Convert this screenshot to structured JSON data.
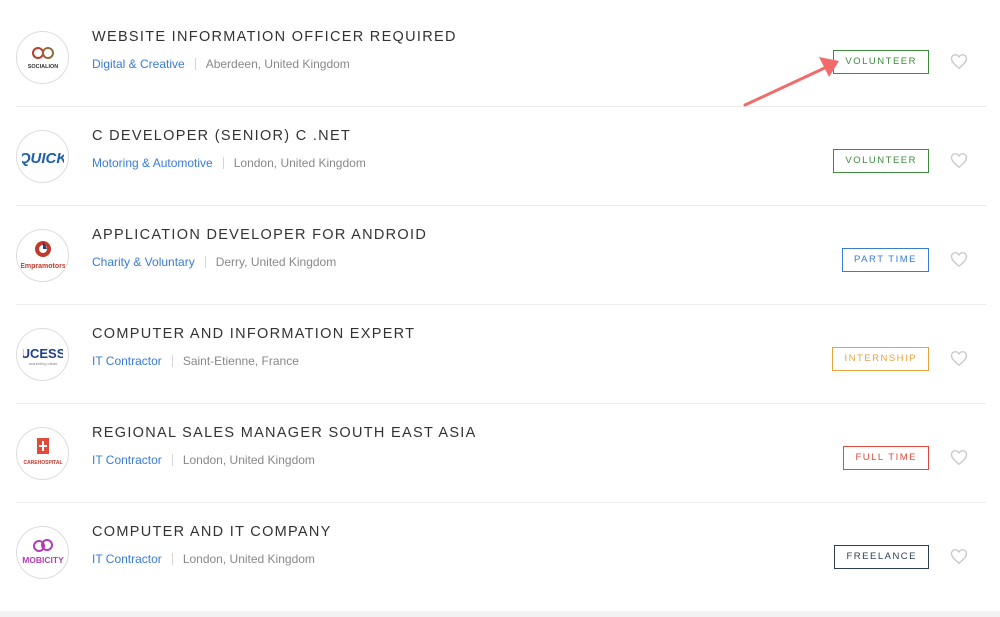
{
  "jobs": [
    {
      "title": "WEBSITE INFORMATION OFFICER REQUIRED",
      "category": "Digital & Creative",
      "location": "Aberdeen, United Kingdom",
      "type": "VOLUNTEER",
      "type_color": "#3d8b3d",
      "logo": {
        "name": "socialion-logo",
        "text": "SOCIALION"
      }
    },
    {
      "title": "C DEVELOPER (SENIOR) C .NET",
      "category": "Motoring & Automotive",
      "location": "London, United Kingdom",
      "type": "VOLUNTEER",
      "type_color": "#3d8b3d",
      "logo": {
        "name": "quick-logo",
        "text": "QUICK"
      }
    },
    {
      "title": "APPLICATION DEVELOPER FOR ANDROID",
      "category": "Charity & Voluntary",
      "location": "Derry, United Kingdom",
      "type": "PART TIME",
      "type_color": "#3a7bd5",
      "logo": {
        "name": "empramotors-logo",
        "text": "Empramotors"
      }
    },
    {
      "title": "COMPUTER AND INFORMATION EXPERT",
      "category": "IT Contractor",
      "location": "Saint-Etienne, France",
      "type": "INTERNSHIP",
      "type_color": "#e8a23a",
      "logo": {
        "name": "ucess-logo",
        "text": "UCESS",
        "subtext": "marketing ideas"
      }
    },
    {
      "title": "REGIONAL SALES MANAGER SOUTH EAST ASIA",
      "category": "IT Contractor",
      "location": "London, United Kingdom",
      "type": "FULL TIME",
      "type_color": "#e24a3b",
      "logo": {
        "name": "carehospital-logo",
        "text": "CAREHOSPITAL"
      }
    },
    {
      "title": "COMPUTER AND IT COMPANY",
      "category": "IT Contractor",
      "location": "London, United Kingdom",
      "type": "FREELANCE",
      "type_color": "#2c3e50",
      "logo": {
        "name": "mobicity-logo",
        "text": "MOBICITY"
      }
    }
  ],
  "icons": {
    "favorite": "heart-outline-icon",
    "annotation": "red-arrow-annotation"
  },
  "colors": {
    "link": "#3a7bd5",
    "text": "#333333",
    "muted": "#888888",
    "heart": "#c8c8c8",
    "arrow": "#f26b6b"
  }
}
